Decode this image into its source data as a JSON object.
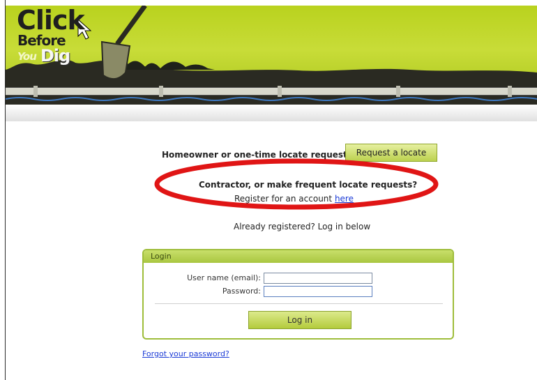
{
  "banner": {
    "logo_click": "Click",
    "logo_before": "Before",
    "logo_you": "You",
    "logo_dig": "Dig"
  },
  "prompt": {
    "homeowner_text": "Homeowner or one-time locate request?",
    "request_button": "Request a locate",
    "contractor_text": "Contractor, or make frequent locate requests?",
    "register_text": "Register for an account ",
    "register_link": "here",
    "already_text": "Already registered? Log in below"
  },
  "login": {
    "title": "Login",
    "username_label": "User name (email):",
    "username_value": "",
    "password_label": "Password:",
    "password_value": "",
    "button": "Log in"
  },
  "forgot_link": "Forgot your password?",
  "colors": {
    "banner_green": "#b9d21e",
    "highlight_red": "#e01515",
    "link_blue": "#1a3ad6"
  }
}
